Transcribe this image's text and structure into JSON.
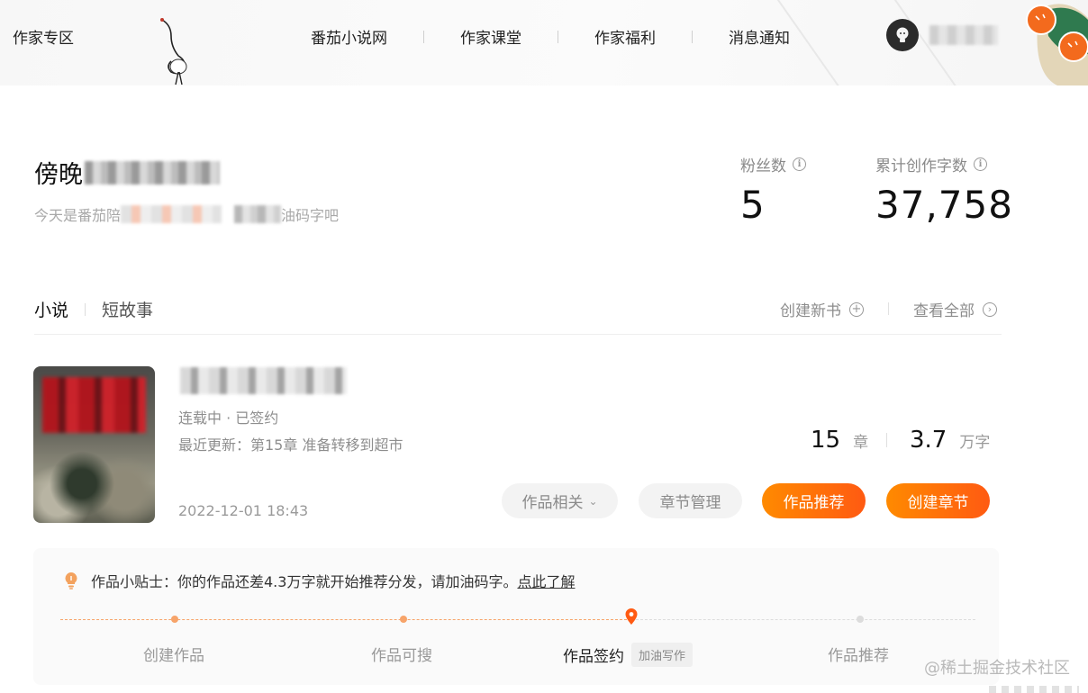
{
  "header": {
    "brand": "作家专区",
    "nav": [
      {
        "id": "fanqie",
        "label": "番茄小说网"
      },
      {
        "id": "classroom",
        "label": "作家课堂"
      },
      {
        "id": "welfare",
        "label": "作家福利"
      },
      {
        "id": "messages",
        "label": "消息通知"
      }
    ],
    "avatar_icon": "bulb-avatar-icon"
  },
  "profile": {
    "name_visible": "傍晚",
    "subtitle_prefix": "今天是番茄陪",
    "subtitle_suffix": "油码字吧"
  },
  "stats": {
    "fans_label": "粉丝数",
    "fans_value": "5",
    "words_label": "累计创作字数",
    "words_value": "37,758"
  },
  "tabs": {
    "novel": "小说",
    "short_story": "短故事"
  },
  "actions": {
    "create_book": "创建新书",
    "view_all": "查看全部"
  },
  "book": {
    "status": "连载中 · 已签约",
    "latest_update": "最近更新：第15章 准备转移到超市",
    "date": "2022-12-01 18:43",
    "chapters_num": "15",
    "chapters_unit": "章",
    "words_num": "3.7",
    "words_unit": "万字",
    "buttons": {
      "related": "作品相关",
      "chapter_manage": "章节管理",
      "recommend": "作品推荐",
      "create_chapter": "创建章节"
    }
  },
  "tips": {
    "text": "作品小贴士：你的作品还差4.3万字就开始推荐分发，请加油码字。",
    "link": "点此了解",
    "steps": [
      {
        "label": "创建作品",
        "done": true
      },
      {
        "label": "作品可搜",
        "done": true
      },
      {
        "label": "作品签约",
        "done": true,
        "current": true,
        "badge": "加油写作"
      },
      {
        "label": "作品推荐",
        "done": false
      }
    ]
  },
  "watermark": "@稀土掘金技术社区",
  "colors": {
    "accent_orange": "#ff6a0d",
    "progress_done": "#f7a46a",
    "progress_todo": "#dcdcdc"
  }
}
